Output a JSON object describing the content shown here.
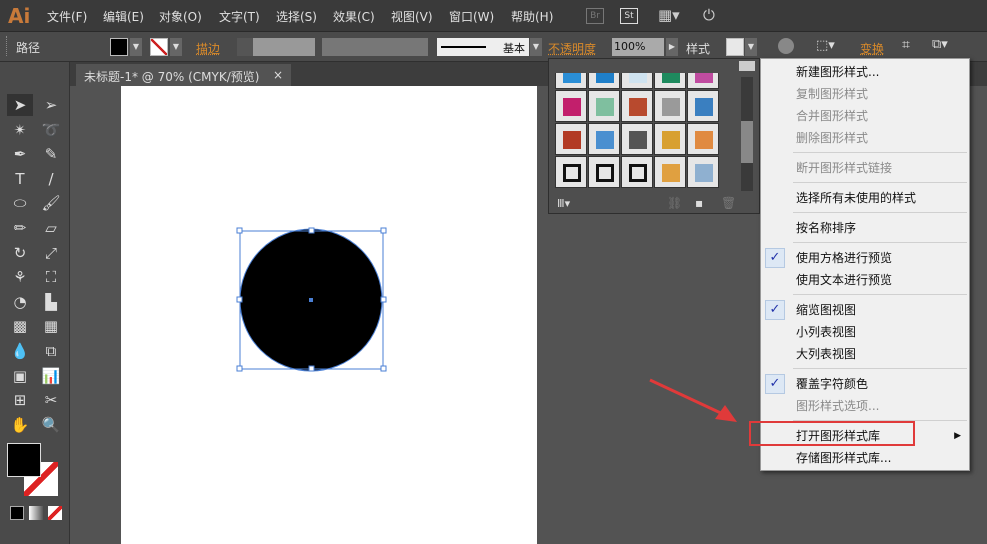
{
  "app": {
    "logo": "Ai",
    "menus": [
      "文件(F)",
      "编辑(E)",
      "对象(O)",
      "文字(T)",
      "选择(S)",
      "效果(C)",
      "视图(V)",
      "窗口(W)",
      "帮助(H)"
    ],
    "icons": [
      "bridge-icon",
      "stock-icon",
      "workspace-icon",
      "sync-icon"
    ],
    "br": "Br",
    "st": "St"
  },
  "control": {
    "object_type": "路径",
    "stroke_label": "描边",
    "stroke_profile": "基本",
    "opacity_label": "不透明度",
    "opacity_value": "100%",
    "style_label": "样式",
    "transform_label": "变换",
    "fill_color": "#000000"
  },
  "document": {
    "tab_title": "未标题-1* @ 70% (CMYK/预览)",
    "close": "×"
  },
  "tools": [
    "select",
    "direct-select",
    "magic-wand",
    "lasso",
    "pen",
    "curvature",
    "type",
    "line",
    "ellipse",
    "paintbrush",
    "pencil",
    "eraser",
    "rotate",
    "scale",
    "warp",
    "free-transform",
    "shape-builder",
    "perspective",
    "mesh",
    "gradient",
    "eyedropper",
    "blend",
    "symbol-sprayer",
    "column-graph",
    "artboard",
    "slice",
    "hand",
    "zoom"
  ],
  "menu": {
    "items": [
      {
        "label": "新建图形样式...",
        "enabled": true
      },
      {
        "label": "复制图形样式",
        "enabled": false
      },
      {
        "label": "合并图形样式",
        "enabled": false
      },
      {
        "label": "删除图形样式",
        "enabled": false
      },
      {
        "sep": true
      },
      {
        "label": "断开图形样式链接",
        "enabled": false
      },
      {
        "sep": true
      },
      {
        "label": "选择所有未使用的样式",
        "enabled": true
      },
      {
        "sep": true
      },
      {
        "label": "按名称排序",
        "enabled": true
      },
      {
        "sep": true
      },
      {
        "label": "使用方格进行预览",
        "enabled": true,
        "checked": true
      },
      {
        "label": "使用文本进行预览",
        "enabled": true
      },
      {
        "sep": true
      },
      {
        "label": "缩览图视图",
        "enabled": true,
        "checked": true
      },
      {
        "label": "小列表视图",
        "enabled": true
      },
      {
        "label": "大列表视图",
        "enabled": true
      },
      {
        "sep": true
      },
      {
        "label": "覆盖字符颜色",
        "enabled": true,
        "checked": true
      },
      {
        "label": "图形样式选项...",
        "enabled": false
      },
      {
        "sep": true
      },
      {
        "label": "打开图形样式库",
        "enabled": true,
        "submenu": true,
        "highlighted": true
      },
      {
        "label": "存储图形样式库...",
        "enabled": true
      }
    ]
  },
  "colors": {
    "accent": "#e03a3a",
    "selection": "#4a7fd4",
    "label_orange": "#d98a2a"
  }
}
